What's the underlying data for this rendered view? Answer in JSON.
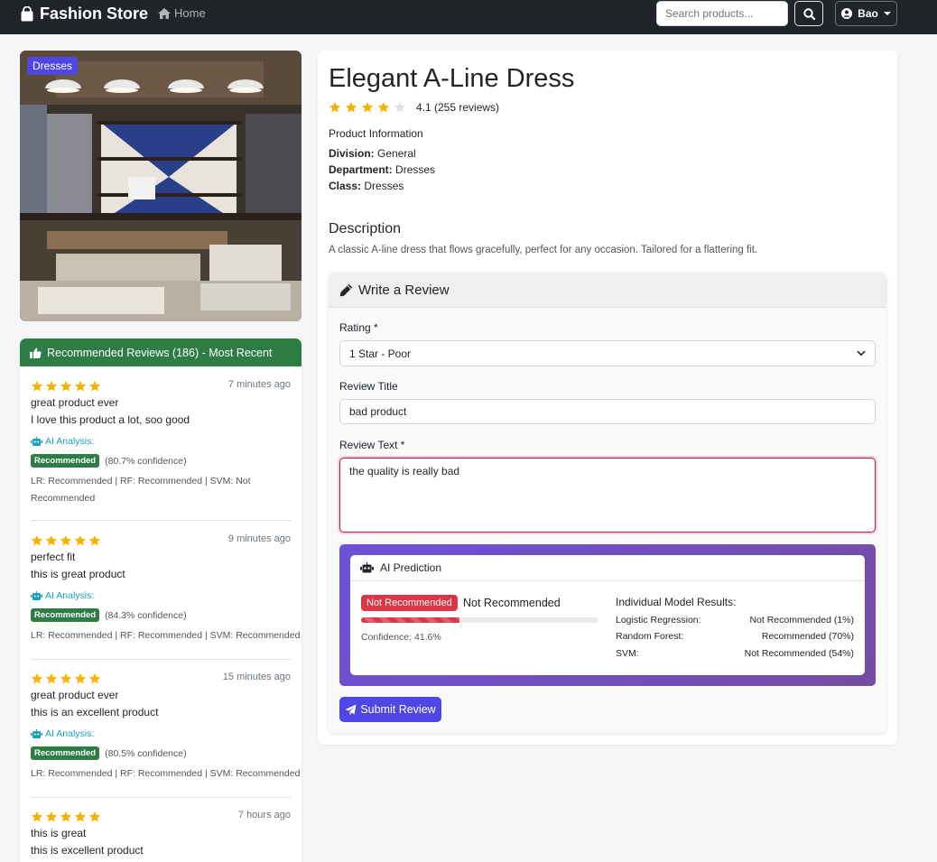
{
  "navbar": {
    "brand": "Fashion Store",
    "home_label": "Home",
    "search_placeholder": "Search products...",
    "user_label": "Bao"
  },
  "product": {
    "category_badge": "Dresses",
    "title": "Elegant A-Line Dress",
    "rating_text": "4.1 (255 reviews)",
    "rating_value": 4.1,
    "info_heading": "Product Information",
    "division_label": "Division:",
    "division_value": "General",
    "department_label": "Department:",
    "department_value": "Dresses",
    "class_label": "Class:",
    "class_value": "Dresses",
    "description_heading": "Description",
    "description": "A classic A-line dress that flows gracefully, perfect for any occasion. Tailored for a flattering fit."
  },
  "reviews_panel": {
    "header": "Recommended Reviews (186) - Most Recent",
    "items": [
      {
        "stars": 5,
        "time": "7 minutes ago",
        "title": "great product ever",
        "text": "I love this product a lot, soo good",
        "ai_label": "AI Analysis:",
        "badge": "Recommended",
        "confidence": "(80.7% confidence)",
        "models": "LR: Recommended | RF: Recommended | SVM: Not Recommended"
      },
      {
        "stars": 5,
        "time": "9 minutes ago",
        "title": "perfect fit",
        "text": "this is great product",
        "ai_label": "AI Analysis:",
        "badge": "Recommended",
        "confidence": "(84.3% confidence)",
        "models": "LR: Recommended | RF: Recommended | SVM: Recommended"
      },
      {
        "stars": 5,
        "time": "15 minutes ago",
        "title": "great product ever",
        "text": "this is an excellent product",
        "ai_label": "AI Analysis:",
        "badge": "Recommended",
        "confidence": "(80.5% confidence)",
        "models": "LR: Recommended | RF: Recommended | SVM: Recommended"
      },
      {
        "stars": 5,
        "time": "7 hours ago",
        "title": "this is great",
        "text": "this is excellent product"
      }
    ]
  },
  "form": {
    "header": "Write a Review",
    "rating_label": "Rating *",
    "rating_value": "1 Star - Poor",
    "title_label": "Review Title",
    "title_value": "bad product",
    "text_label": "Review Text *",
    "text_value": "the quality is really bad",
    "submit_label": "Submit Review"
  },
  "ai_prediction": {
    "header": "AI Prediction",
    "badge": "Not Recommended",
    "result": "Not Recommended",
    "confidence_value": 41.6,
    "confidence_label": "Confidence: 41.6%",
    "models_heading": "Individual Model Results:",
    "models": [
      {
        "name": "Logistic Regression:",
        "result": "Not Recommended (1%)"
      },
      {
        "name": "Random Forest:",
        "result": "Recommended (70%)"
      },
      {
        "name": "SVM:",
        "result": "Not Recommended (54%)"
      }
    ]
  },
  "colors": {
    "navbar": "#212529",
    "accent": "#4f46e5",
    "success": "#2e7d45",
    "danger": "#dc3545",
    "star": "#f5b301",
    "ai_gradient_start": "#6d52d8",
    "ai_gradient_end": "#764ba2"
  }
}
